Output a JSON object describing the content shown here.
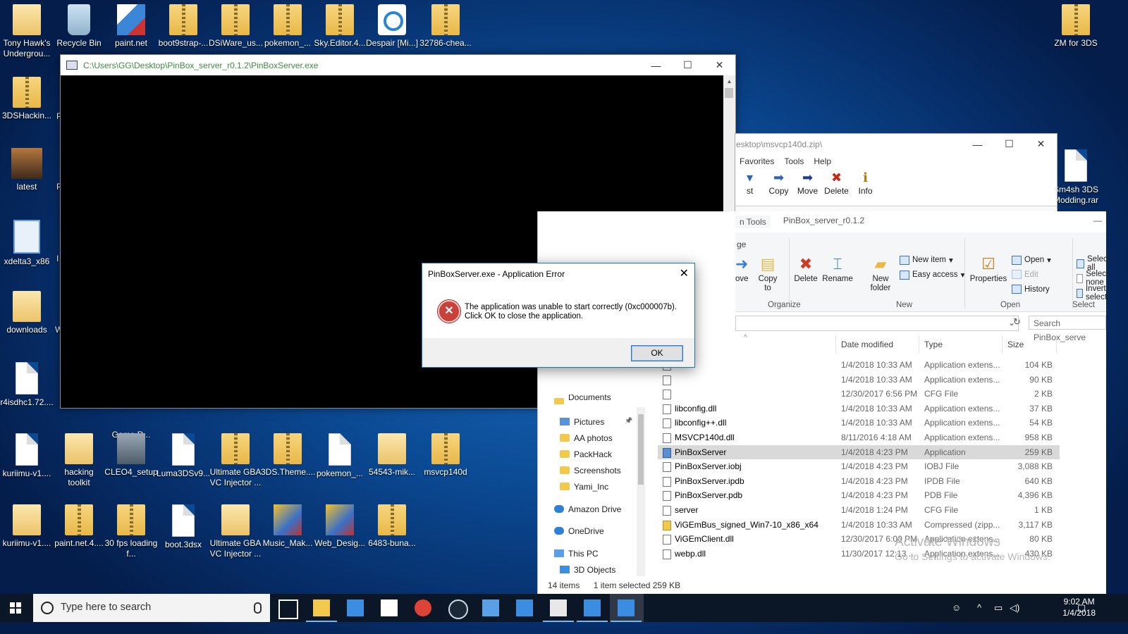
{
  "desktop": {
    "icons": [
      {
        "label": "Tony Hawk's Undergrou...",
        "icon": "folder-icon"
      },
      {
        "label": "Recycle Bin",
        "icon": "recycle-bin-icon"
      },
      {
        "label": "paint.net",
        "icon": "paintnet-icon"
      },
      {
        "label": "boot9strap-...",
        "icon": "zip-folder-icon"
      },
      {
        "label": "DSiWare_us...",
        "icon": "zip-folder-icon"
      },
      {
        "label": "pokemon_...",
        "icon": "zip-folder-icon"
      },
      {
        "label": "Sky.Editor.4...",
        "icon": "zip-folder-icon"
      },
      {
        "label": "Despair [Mi...]",
        "icon": "app-icon"
      },
      {
        "label": "32786-chea...",
        "icon": "zip-folder-icon"
      },
      {
        "label": "ZM for 3DS",
        "icon": "zip-folder-icon"
      },
      {
        "label": "3DSHackin...",
        "icon": "zip-folder-icon"
      },
      {
        "label": "latest",
        "icon": "latest-icon"
      },
      {
        "label": "xdelta3_x86",
        "icon": "xdelta-icon"
      },
      {
        "label": "downloads",
        "icon": "folder-icon"
      },
      {
        "label": "r4isdhc1.72....",
        "icon": "file-icon"
      },
      {
        "label": "Sm4sh 3DS Modding.rar",
        "icon": "file-icon"
      },
      {
        "label": "Game R...",
        "icon": "folder-icon"
      },
      {
        "label": "kuriimu-v1....",
        "icon": "file-icon"
      },
      {
        "label": "hacking toolkit",
        "icon": "folder-icon"
      },
      {
        "label": "CLEO4_setup",
        "icon": "setup-icon"
      },
      {
        "label": "Luma3DSv9...",
        "icon": "file-icon"
      },
      {
        "label": "Ultimate GBA VC Injector ...",
        "icon": "zip-folder-icon"
      },
      {
        "label": "3DS.Theme....",
        "icon": "zip-folder-icon"
      },
      {
        "label": "pokemon_...",
        "icon": "file-icon"
      },
      {
        "label": "54543-mik...",
        "icon": "folder-icon"
      },
      {
        "label": "msvcp140d",
        "icon": "zip-folder-icon"
      },
      {
        "label": "kuriimu-v1....",
        "icon": "folder-icon"
      },
      {
        "label": "paint.net.4....",
        "icon": "zip-folder-icon"
      },
      {
        "label": "30 fps loading f...",
        "icon": "zip-folder-icon"
      },
      {
        "label": "boot.3dsx",
        "icon": "file-icon"
      },
      {
        "label": "Ultimate GBA VC Injector ...",
        "icon": "folder-icon"
      },
      {
        "label": "Music_Mak...",
        "icon": "winrar-icon"
      },
      {
        "label": "Web_Desig...",
        "icon": "winrar-icon"
      },
      {
        "label": "6483-buna...",
        "icon": "zip-folder-icon"
      }
    ],
    "partial_letters": [
      "P",
      "P",
      "I",
      "W"
    ]
  },
  "console": {
    "title": "C:\\Users\\GG\\Desktop\\PinBox_server_r0.1.2\\PinBoxServer.exe",
    "minimize": "—",
    "maximize": "☐",
    "close": "✕"
  },
  "zip": {
    "title": "esktop\\msvcp140d.zip\\",
    "menu": [
      "Favorites",
      "Tools",
      "Help"
    ],
    "toolbar": [
      {
        "label": "st",
        "icon": "▾"
      },
      {
        "label": "Copy",
        "icon": "➡"
      },
      {
        "label": "Move",
        "icon": "➡"
      },
      {
        "label": "Delete",
        "icon": "✖"
      },
      {
        "label": "Info",
        "icon": "ℹ"
      }
    ],
    "minimize": "—",
    "maximize": "☐",
    "close": "✕"
  },
  "explorer": {
    "tabs": [
      "n Tools",
      "PinBox_server_r0.1.2"
    ],
    "tab_sub": "ge",
    "ribbon": {
      "move_label": "ove",
      "copy_to": "Copy to",
      "delete": "Delete",
      "rename": "Rename",
      "new_folder": "New folder",
      "new_item": "New item",
      "easy_access": "Easy access",
      "properties": "Properties",
      "open": "Open",
      "edit": "Edit",
      "history": "History",
      "select_all": "Select all",
      "select_none": "Select none",
      "invert": "Invert selecti",
      "groups": {
        "organize": "Organize",
        "new": "New",
        "open": "Open",
        "select": "Select"
      }
    },
    "search_placeholder": "Search PinBox_serve",
    "columns": {
      "date": "Date modified",
      "type": "Type",
      "size": "Size"
    },
    "files": [
      {
        "name": "",
        "date": "1/4/2018 10:33 AM",
        "type": "Application extens...",
        "size": "104 KB",
        "icon": "dll"
      },
      {
        "name": "",
        "date": "1/4/2018 10:33 AM",
        "type": "Application extens...",
        "size": "90 KB",
        "icon": "dll"
      },
      {
        "name": "",
        "date": "12/30/2017 6:56 PM",
        "type": "CFG File",
        "size": "2 KB",
        "icon": "file"
      },
      {
        "name": "libconfig.dll",
        "date": "1/4/2018 10:33 AM",
        "type": "Application extens...",
        "size": "37 KB",
        "icon": "dll"
      },
      {
        "name": "libconfig++.dll",
        "date": "1/4/2018 10:33 AM",
        "type": "Application extens...",
        "size": "54 KB",
        "icon": "dll"
      },
      {
        "name": "MSVCP140d.dll",
        "date": "8/11/2016 4:18 AM",
        "type": "Application extens...",
        "size": "958 KB",
        "icon": "dll"
      },
      {
        "name": "PinBoxServer",
        "date": "1/4/2018 4:23 PM",
        "type": "Application",
        "size": "259 KB",
        "icon": "app",
        "selected": true
      },
      {
        "name": "PinBoxServer.iobj",
        "date": "1/4/2018 4:23 PM",
        "type": "IOBJ File",
        "size": "3,088 KB",
        "icon": "file"
      },
      {
        "name": "PinBoxServer.ipdb",
        "date": "1/4/2018 4:23 PM",
        "type": "IPDB File",
        "size": "640 KB",
        "icon": "file"
      },
      {
        "name": "PinBoxServer.pdb",
        "date": "1/4/2018 4:23 PM",
        "type": "PDB File",
        "size": "4,396 KB",
        "icon": "file"
      },
      {
        "name": "server",
        "date": "1/4/2018 1:24 PM",
        "type": "CFG File",
        "size": "1 KB",
        "icon": "file"
      },
      {
        "name": "ViGEmBus_signed_Win7-10_x86_x64",
        "date": "1/4/2018 10:33 AM",
        "type": "Compressed (zipp...",
        "size": "3,117 KB",
        "icon": "zip"
      },
      {
        "name": "ViGEmClient.dll",
        "date": "12/30/2017 6:00 PM",
        "type": "Application extens...",
        "size": "80 KB",
        "icon": "dll"
      },
      {
        "name": "webp.dll",
        "date": "11/30/2017 12:13 ...",
        "type": "Application extens...",
        "size": "430 KB",
        "icon": "dll"
      }
    ],
    "nav": [
      {
        "label": "Documents",
        "icon": "folder"
      },
      {
        "label": "Pictures",
        "icon": "pic"
      },
      {
        "label": "AA photos",
        "icon": "folder"
      },
      {
        "label": "PackHack",
        "icon": "folder"
      },
      {
        "label": "Screenshots",
        "icon": "folder"
      },
      {
        "label": "Yami_Inc",
        "icon": "folder"
      },
      {
        "label": "Amazon Drive",
        "icon": "cloud"
      },
      {
        "label": "OneDrive",
        "icon": "cloud"
      },
      {
        "label": "This PC",
        "icon": "pc"
      },
      {
        "label": "3D Objects",
        "icon": "obj"
      }
    ],
    "status": {
      "count": "14 items",
      "selected": "1 item selected  259 KB"
    },
    "watermark": {
      "title": "Activate Windows",
      "subtitle": "Go to Settings to activate Windows."
    }
  },
  "dialog": {
    "title": "PinBoxServer.exe - Application Error",
    "close": "✕",
    "line1": "The application was unable to start correctly (0xc000007b).",
    "line2": "Click OK to close the application.",
    "ok": "OK"
  },
  "taskbar": {
    "search_placeholder": "Type here to search",
    "time": "9:02 AM",
    "date": "1/4/2018",
    "apps": [
      "task-view-icon",
      "file-explorer-icon",
      "store-icon",
      "mail-icon",
      "chrome-icon",
      "steam-icon",
      "app-icon",
      "app-icon",
      "7zip-icon",
      "window-icon",
      "window-icon"
    ]
  },
  "colors": {
    "accent": "#1c73d6",
    "error": "#c8413a",
    "selected_row": "#d9d9d9"
  }
}
